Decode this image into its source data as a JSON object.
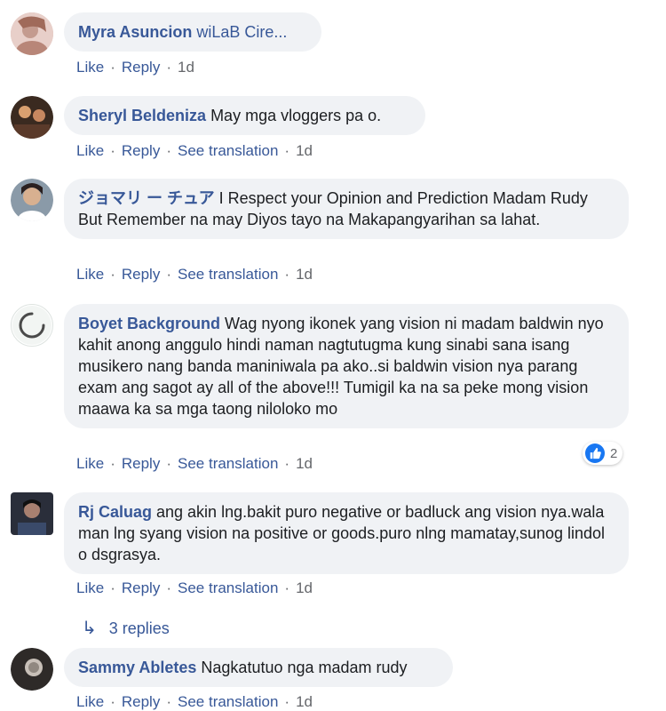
{
  "comments": [
    {
      "author": "Myra Asuncion",
      "text": "wiLaB Cire...",
      "actions": {
        "like": "Like",
        "reply": "Reply",
        "time": "1d"
      }
    },
    {
      "author": "Sheryl Beldeniza",
      "text": "May mga vloggers pa o.",
      "actions": {
        "like": "Like",
        "reply": "Reply",
        "translate": "See translation",
        "time": "1d"
      }
    },
    {
      "author": "ジョマリ ー チュア",
      "text": "I Respect your Opinion and Prediction Madam Rudy But Remember na may Diyos tayo na Makapangyarihan sa lahat.",
      "actions": {
        "like": "Like",
        "reply": "Reply",
        "translate": "See translation",
        "time": "1d"
      }
    },
    {
      "author": "Boyet Background",
      "text": "Wag nyong ikonek yang vision ni madam baldwin nyo kahit anong anggulo hindi naman nagtutugma kung sinabi sana isang musikero nang banda maniniwala pa ako..si baldwin vision nya parang exam ang sagot ay all of the above!!! Tumigil ka na sa peke mong vision maawa ka sa mga taong niloloko mo",
      "actions": {
        "like": "Like",
        "reply": "Reply",
        "translate": "See translation",
        "time": "1d"
      },
      "reaction_count": "2"
    },
    {
      "author": "Rj Caluag",
      "text": "ang akin lng.bakit puro negative or badluck ang vision nya.wala man lng syang vision na positive or goods.puro nlng mamatay,sunog lindol o dsgrasya.",
      "actions": {
        "like": "Like",
        "reply": "Reply",
        "translate": "See translation",
        "time": "1d"
      },
      "replies_label": "3 replies"
    },
    {
      "author": "Sammy Abletes",
      "text": "Nagkatutuo nga madam rudy",
      "actions": {
        "like": "Like",
        "reply": "Reply",
        "translate": "See translation",
        "time": "1d"
      }
    }
  ],
  "colors": {
    "name": "#385898",
    "bubble": "#f0f2f5",
    "like_blue": "#1877f2"
  }
}
